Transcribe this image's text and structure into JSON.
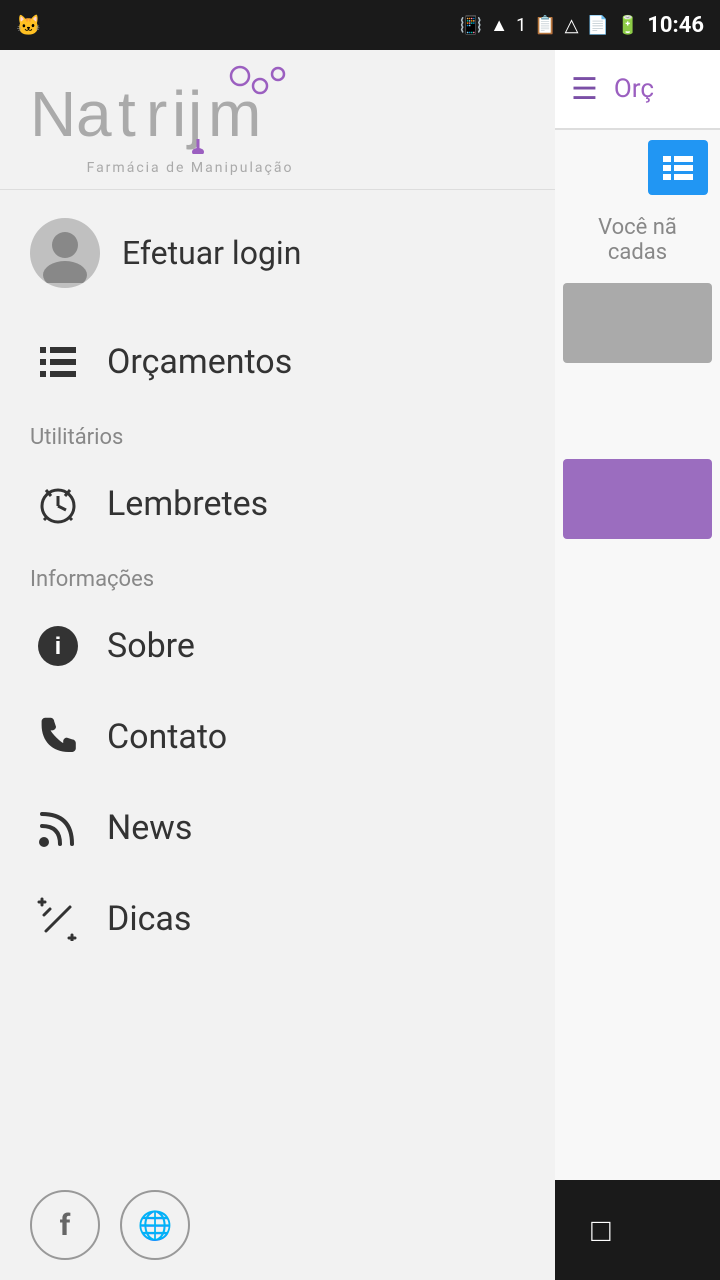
{
  "statusBar": {
    "time": "10:46",
    "leftIcon": "🐱"
  },
  "logo": {
    "text": "Natrijm",
    "subtitle": "Farmácia de Manipulação"
  },
  "drawer": {
    "userItem": {
      "label": "Efetuar login"
    },
    "mainItems": [
      {
        "id": "orcamentos",
        "icon": "list",
        "label": "Orçamentos"
      }
    ],
    "sections": [
      {
        "header": "Utilitários",
        "items": [
          {
            "id": "lembretes",
            "icon": "clock",
            "label": "Lembretes"
          }
        ]
      },
      {
        "header": "Informações",
        "items": [
          {
            "id": "sobre",
            "icon": "info",
            "label": "Sobre"
          },
          {
            "id": "contato",
            "icon": "phone",
            "label": "Contato"
          },
          {
            "id": "news",
            "icon": "rss",
            "label": "News"
          },
          {
            "id": "dicas",
            "icon": "magic",
            "label": "Dicas"
          }
        ]
      }
    ],
    "socialButtons": [
      {
        "id": "facebook",
        "icon": "f"
      },
      {
        "id": "website",
        "icon": "🌐"
      }
    ]
  },
  "rightPanel": {
    "headerMenuIcon": "☰",
    "headerOrgText": "Orç",
    "emptyText1": "Você nã",
    "emptyText2": "cadas",
    "listIconLabel": "list-view"
  },
  "navBar": {
    "backLabel": "◁",
    "homeLabel": "○",
    "recentLabel": "□"
  }
}
